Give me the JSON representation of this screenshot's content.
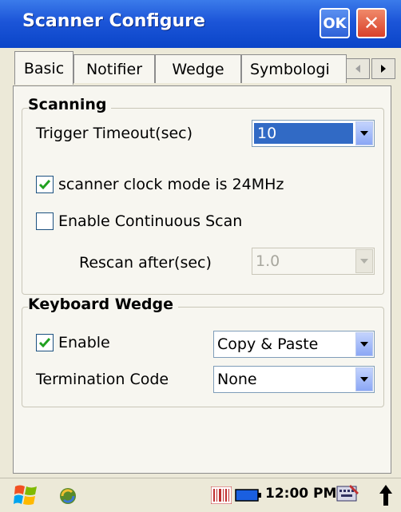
{
  "window": {
    "title": "Scanner Configure",
    "ok_label": "OK",
    "close_label": "✕"
  },
  "tabs": [
    {
      "label": "Basic",
      "active": true
    },
    {
      "label": "Notifier",
      "active": false
    },
    {
      "label": "Wedge",
      "active": false
    },
    {
      "label": "Symbologi",
      "active": false
    }
  ],
  "scanning": {
    "title": "Scanning",
    "trigger_timeout_label": "Trigger Timeout(sec)",
    "trigger_timeout_value": "10",
    "clock_mode_label": "scanner clock mode is 24MHz",
    "clock_mode_checked": true,
    "continuous_label": "Enable Continuous Scan",
    "continuous_checked": false,
    "rescan_label": "Rescan after(sec)",
    "rescan_value": "1.0"
  },
  "keyboard_wedge": {
    "title": "Keyboard Wedge",
    "enable_label": "Enable",
    "enable_checked": true,
    "mode_value": "Copy & Paste",
    "termination_label": "Termination Code",
    "termination_value": "None"
  },
  "taskbar": {
    "time": "12:00 PM"
  },
  "colors": {
    "titlebar": "#1C55D8",
    "selection": "#316AC5",
    "check": "#21A121"
  }
}
